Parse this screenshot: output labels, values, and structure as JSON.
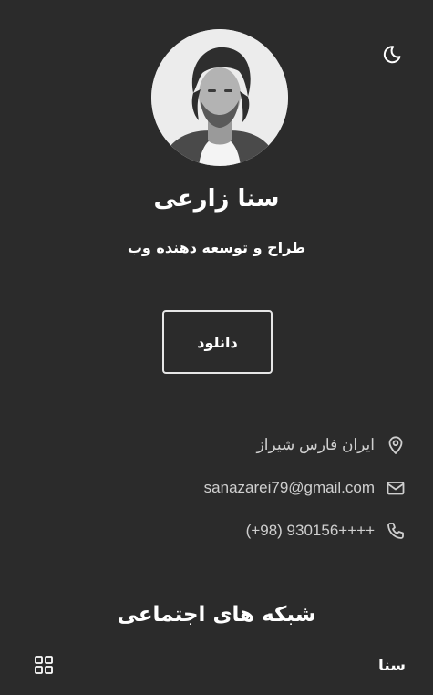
{
  "header": {
    "theme_toggle_icon": "moon-icon"
  },
  "profile": {
    "avatar_icon": "avatar-photo",
    "name": "سنا زارعی",
    "job_title": "طراح و توسعه دهنده وب",
    "download_label": "دانلود"
  },
  "contact": {
    "location": {
      "icon": "location-pin-icon",
      "text": "ایران فارس شیراز"
    },
    "email": {
      "icon": "mail-icon",
      "text": "sanazarei79@gmail.com"
    },
    "phone": {
      "icon": "phone-icon",
      "text": "(+98) 930156++++"
    }
  },
  "social": {
    "title": "شبکه های اجتماعی"
  },
  "bottom_nav": {
    "brand": "سنا",
    "menu_icon": "grid-menu-icon"
  },
  "colors": {
    "background": "#2b2b2b",
    "text": "#ffffff",
    "muted_text": "#cfcfcf",
    "border": "#e6e6e6"
  }
}
